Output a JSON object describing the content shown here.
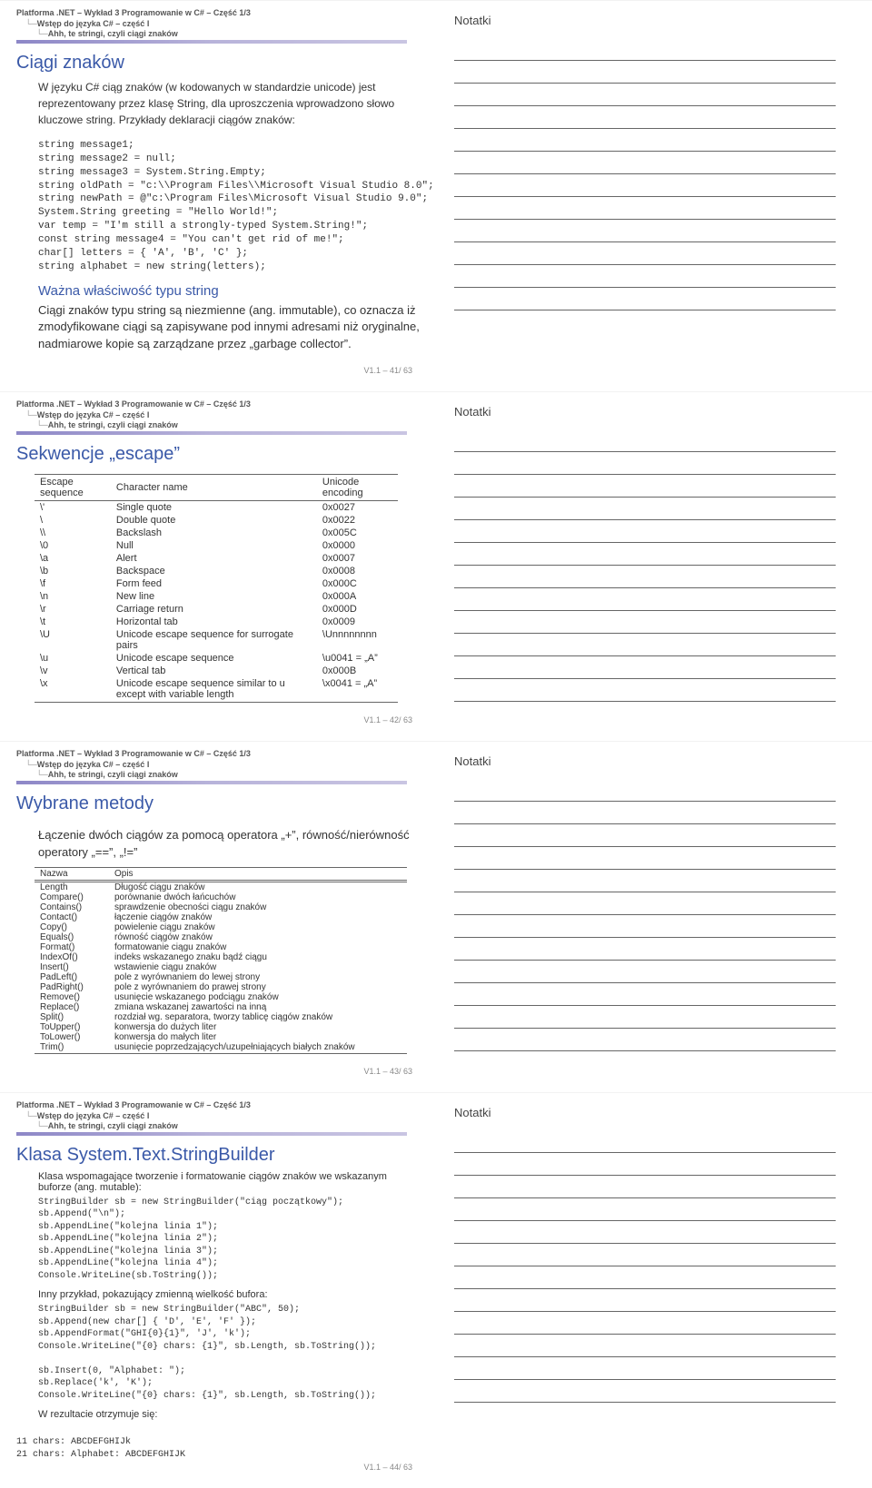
{
  "breadcrumb": {
    "level1": "Platforma .NET – Wykład 3  Programowanie w C# – Część 1/3",
    "level2": "Wstęp do języka C# – część I",
    "level3": "Ahh, te stringi, czyli ciągi znaków"
  },
  "notes_label": "Notatki",
  "slide1": {
    "title": "Ciągi znaków",
    "body_para1": "W języku C# ciąg znaków (w kodowanych w standardzie unicode) jest reprezentowany przez klasę String, dla uproszczenia wprowadzono słowo kluczowe string.  ",
    "body_para1_tail": "Przykłady deklaracji ciągów znaków:",
    "code": "string message1;\nstring message2 = null;\nstring message3 = System.String.Empty;\nstring oldPath = \"c:\\\\Program Files\\\\Microsoft Visual Studio 8.0\";\nstring newPath = @\"c:\\Program Files\\Microsoft Visual Studio 9.0\";\nSystem.String greeting = \"Hello World!\";\nvar temp = \"I'm still a strongly-typed System.String!\";\nconst string message4 = \"You can't get rid of me!\";\nchar[] letters = { 'A', 'B', 'C' };\nstring alphabet = new string(letters);",
    "subhead": "Ważna właściwość typu string",
    "subpara": "Ciągi znaków typu string są niezmienne (ang. immutable), co oznacza iż zmodyfikowane ciągi są zapisywane pod innymi adresami niż oryginalne, nadmiarowe kopie są zarządzane przez „garbage collector”.",
    "footer": "V1.1 – 41/ 63"
  },
  "slide2": {
    "title": "Sekwencje „escape”",
    "headers": [
      "Escape sequence",
      "Character name",
      "Unicode encoding"
    ],
    "rows": [
      [
        "\\'",
        "Single quote",
        "0x0027"
      ],
      [
        "\\",
        "Double quote",
        "0x0022"
      ],
      [
        "\\\\",
        "Backslash",
        "0x005C"
      ],
      [
        "\\0",
        "Null",
        "0x0000"
      ],
      [
        "\\a",
        "Alert",
        "0x0007"
      ],
      [
        "\\b",
        "Backspace",
        "0x0008"
      ],
      [
        "\\f",
        "Form feed",
        "0x000C"
      ],
      [
        "\\n",
        "New line",
        "0x000A"
      ],
      [
        "\\r",
        "Carriage return",
        "0x000D"
      ],
      [
        "\\t",
        "Horizontal tab",
        "0x0009"
      ],
      [
        "\\U",
        "Unicode escape sequence for surrogate pairs",
        "\\Unnnnnnnn"
      ],
      [
        "\\u",
        "Unicode escape sequence",
        "\\u0041 = „A”"
      ],
      [
        "\\v",
        "Vertical tab",
        "0x000B"
      ],
      [
        "\\x",
        "Unicode escape sequence similar to u except with variable length",
        "\\x0041 = „A”"
      ]
    ],
    "footer": "V1.1 – 42/ 63"
  },
  "slide3": {
    "title": "Wybrane metody",
    "intro": "Łączenie dwóch ciągów za pomocą operatora „+”, równość/nierówność operatory „==”, „!=”",
    "headers": [
      "Nazwa",
      "Opis"
    ],
    "rows": [
      [
        "Length",
        "Długość ciągu znaków"
      ],
      [
        "Compare()",
        "porównanie dwóch łańcuchów"
      ],
      [
        "Contains()",
        "sprawdzenie obecności ciągu znaków"
      ],
      [
        "Contact()",
        "łączenie ciągów znaków"
      ],
      [
        "Copy()",
        "powielenie ciągu znaków"
      ],
      [
        "Equals()",
        "równość ciągów znaków"
      ],
      [
        "Format()",
        "formatowanie ciągu znaków"
      ],
      [
        "IndexOf()",
        "indeks wskazanego znaku bądź ciągu"
      ],
      [
        "Insert()",
        "wstawienie ciągu znaków"
      ],
      [
        "PadLeft()",
        "pole z wyrównaniem do lewej strony"
      ],
      [
        "PadRight()",
        "pole z wyrównaniem do prawej strony"
      ],
      [
        "Remove()",
        "usunięcie wskazanego podciągu znaków"
      ],
      [
        "Replace()",
        "zmiana wskazanej zawartości na inną"
      ],
      [
        "Split()",
        "rozdział wg. separatora, tworzy tablicę ciągów znaków"
      ],
      [
        "ToUpper()",
        "konwersja do dużych liter"
      ],
      [
        "ToLower()",
        "konwersja do małych liter"
      ],
      [
        "Trim()",
        "usunięcie poprzedzających/uzupełniających białych znaków"
      ]
    ],
    "footer": "V1.1 – 43/ 63"
  },
  "slide4": {
    "title": "Klasa System.Text.StringBuilder",
    "para1": "Klasa wspomagające tworzenie i formatowanie ciągów znaków we wskazanym buforze (ang. mutable):",
    "code1": "StringBuilder sb = new StringBuilder(\"ciąg początkowy\");\nsb.Append(\"\\n\");\nsb.AppendLine(\"kolejna linia 1\");\nsb.AppendLine(\"kolejna linia 2\");\nsb.AppendLine(\"kolejna linia 3\");\nsb.AppendLine(\"kolejna linia 4\");\nConsole.WriteLine(sb.ToString());",
    "para2": "Inny przykład, pokazujący zmienną wielkość bufora:",
    "code2": "StringBuilder sb = new StringBuilder(\"ABC\", 50);\nsb.Append(new char[] { 'D', 'E', 'F' });\nsb.AppendFormat(\"GHI{0}{1}\", 'J', 'k');\nConsole.WriteLine(\"{0} chars: {1}\", sb.Length, sb.ToString());\n\nsb.Insert(0, \"Alphabet: \");\nsb.Replace('k', 'K');\nConsole.WriteLine(\"{0} chars: {1}\", sb.Length, sb.ToString());",
    "para3": "W rezultacie otrzymuje się:",
    "code3": "11 chars: ABCDEFGHIJk\n21 chars: Alphabet: ABCDEFGHIJK",
    "footer": "V1.1 – 44/ 63"
  }
}
